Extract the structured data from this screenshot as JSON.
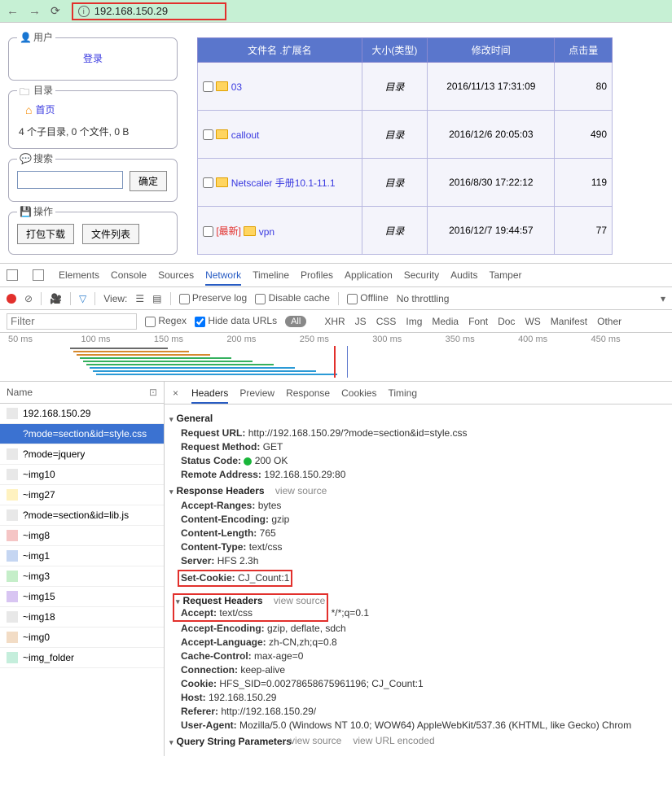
{
  "addr": {
    "url": "192.168.150.29"
  },
  "panels": {
    "user": {
      "title": "用户",
      "login": "登录"
    },
    "dir": {
      "title": "目录",
      "home": "首页",
      "stat": "4 个子目录, 0 个文件, 0 B"
    },
    "search": {
      "title": "搜索",
      "ok": "确定"
    },
    "ops": {
      "title": "操作",
      "pack": "打包下载",
      "list": "文件列表"
    }
  },
  "filetbl": {
    "cols": {
      "name": "文件名 .扩展名",
      "size": "大小(类型)",
      "time": "修改时间",
      "hits": "点击量"
    },
    "rows": [
      {
        "name": "03",
        "size": "目录",
        "time": "2016/11/13 17:31:09",
        "hits": "80",
        "new": false
      },
      {
        "name": "callout",
        "size": "目录",
        "time": "2016/12/6 20:05:03",
        "hits": "490",
        "new": false
      },
      {
        "name": "Netscaler 手册10.1-11.1",
        "size": "目录",
        "time": "2016/8/30 17:22:12",
        "hits": "119",
        "new": false
      },
      {
        "name": "vpn",
        "size": "目录",
        "time": "2016/12/7 19:44:57",
        "hits": "77",
        "new": true
      }
    ],
    "newtag": "[最新]"
  },
  "devtool": {
    "tabs": [
      "Elements",
      "Console",
      "Sources",
      "Network",
      "Timeline",
      "Profiles",
      "Application",
      "Security",
      "Audits",
      "Tamper"
    ],
    "active": "Network",
    "sub": {
      "view": "View:",
      "preserve": "Preserve log",
      "disable": "Disable cache",
      "offline": "Offline",
      "throttle": "No throttling"
    },
    "filter": {
      "ph": "Filter",
      "regex": "Regex",
      "hide": "Hide data URLs",
      "all": "All",
      "types": [
        "XHR",
        "JS",
        "CSS",
        "Img",
        "Media",
        "Font",
        "Doc",
        "WS",
        "Manifest",
        "Other"
      ]
    },
    "timeline": [
      "50 ms",
      "100 ms",
      "150 ms",
      "200 ms",
      "250 ms",
      "300 ms",
      "350 ms",
      "400 ms",
      "450 ms"
    ]
  },
  "reqlist": {
    "head_name": "Name",
    "rows": [
      {
        "n": "192.168.150.29",
        "c": "#e8e8e8"
      },
      {
        "n": "?mode=section&id=style.css",
        "c": "#3b72d1",
        "sel": true
      },
      {
        "n": "?mode=jquery",
        "c": "#e8e8e8"
      },
      {
        "n": "~img10",
        "c": "#e8e8e8"
      },
      {
        "n": "~img27",
        "c": "#fff2c0"
      },
      {
        "n": "?mode=section&id=lib.js",
        "c": "#e8e8e8"
      },
      {
        "n": "~img8",
        "c": "#f5c5c5"
      },
      {
        "n": "~img1",
        "c": "#c5d6f2"
      },
      {
        "n": "~img3",
        "c": "#c5eec9"
      },
      {
        "n": "~img15",
        "c": "#d8c5f2"
      },
      {
        "n": "~img18",
        "c": "#e8e8e8"
      },
      {
        "n": "~img0",
        "c": "#f2dcc5"
      },
      {
        "n": "~img_folder",
        "c": "#c5eedc"
      }
    ]
  },
  "detail": {
    "tabs": [
      "Headers",
      "Preview",
      "Response",
      "Cookies",
      "Timing"
    ],
    "active": "Headers",
    "general": {
      "title": "General",
      "url_k": "Request URL:",
      "url_v": "http://192.168.150.29/?mode=section&id=style.css",
      "method_k": "Request Method:",
      "method_v": "GET",
      "status_k": "Status Code:",
      "status_v": "200 OK",
      "remote_k": "Remote Address:",
      "remote_v": "192.168.150.29:80"
    },
    "resp": {
      "title": "Response Headers",
      "rows": [
        {
          "k": "Accept-Ranges:",
          "v": "bytes"
        },
        {
          "k": "Content-Encoding:",
          "v": "gzip"
        },
        {
          "k": "Content-Length:",
          "v": "765"
        },
        {
          "k": "Content-Type:",
          "v": "text/css"
        },
        {
          "k": "Server:",
          "v": "HFS 2.3h"
        },
        {
          "k": "Set-Cookie:",
          "v": "CJ_Count:1",
          "red": true
        }
      ]
    },
    "req": {
      "title": "Request Headers",
      "accept_k": "Accept:",
      "accept_v": "text/css",
      "accept_tail": " */*;q=0.1",
      "rows": [
        {
          "k": "Accept-Encoding:",
          "v": "gzip, deflate, sdch"
        },
        {
          "k": "Accept-Language:",
          "v": "zh-CN,zh;q=0.8"
        },
        {
          "k": "Cache-Control:",
          "v": "max-age=0"
        },
        {
          "k": "Connection:",
          "v": "keep-alive"
        },
        {
          "k": "Cookie:",
          "v": "HFS_SID=0.00278658675961196; CJ_Count:1"
        },
        {
          "k": "Host:",
          "v": "192.168.150.29"
        },
        {
          "k": "Referer:",
          "v": "http://192.168.150.29/"
        },
        {
          "k": "User-Agent:",
          "v": "Mozilla/5.0 (Windows NT 10.0; WOW64) AppleWebKit/537.36 (KHTML, like Gecko) Chrom"
        }
      ]
    },
    "qsp": {
      "title": "Query String Parameters",
      "vs": "view source",
      "vd": "view URL encoded"
    }
  }
}
